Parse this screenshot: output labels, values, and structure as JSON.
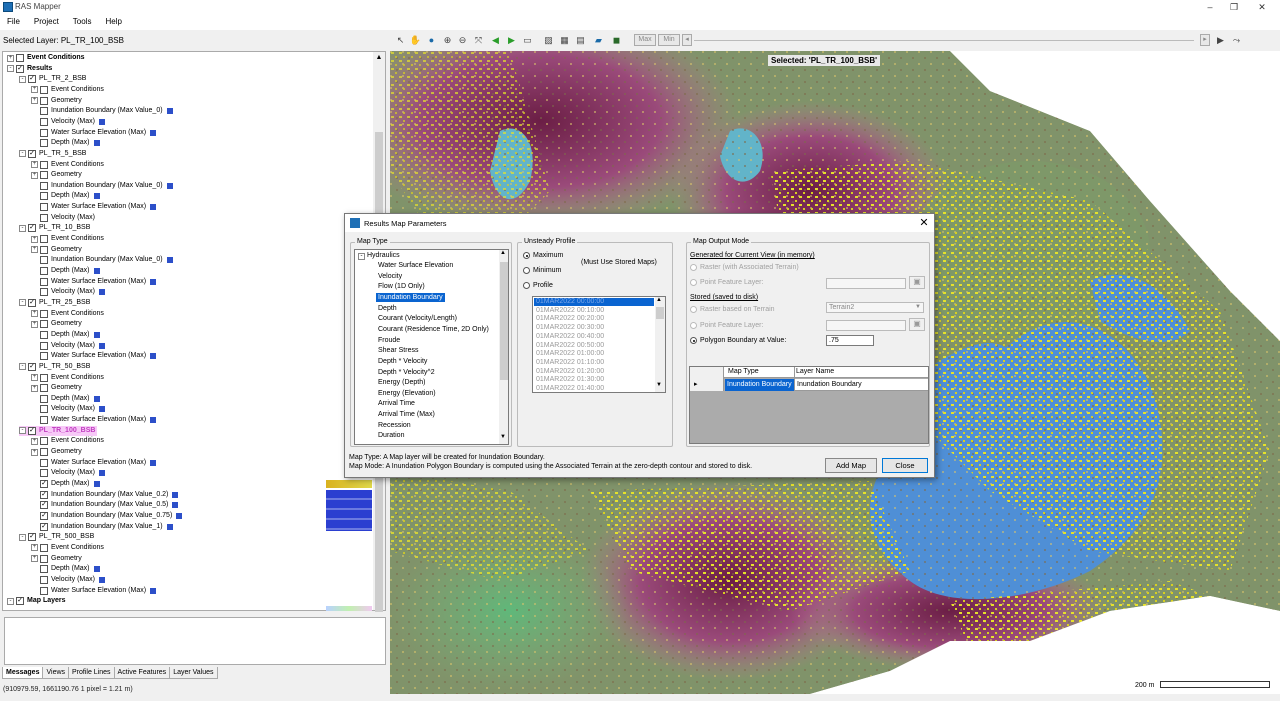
{
  "app": {
    "title": "RAS Mapper",
    "menu": [
      "File",
      "Project",
      "Tools",
      "Help"
    ]
  },
  "selected_layer": "Selected Layer: PL_TR_100_BSB",
  "toolbar": {
    "max_label": "Max",
    "min_label": "Min"
  },
  "map": {
    "selected_banner": "Selected: 'PL_TR_100_BSB'",
    "scale_label": "200 m"
  },
  "status": "(910979.59, 1661190.76  1 pixel = 1.21 m)",
  "bottom_tabs": [
    "Messages",
    "Views",
    "Profile Lines",
    "Active Features",
    "Layer Values"
  ],
  "tree": [
    {
      "t": "Event Conditions",
      "lvl": 0,
      "exp": "+",
      "cb": "",
      "bold": true
    },
    {
      "t": "Results",
      "lvl": 0,
      "exp": "-",
      "cb": "✓",
      "bold": true
    },
    {
      "t": "PL_TR_2_BSB",
      "lvl": 1,
      "exp": "-",
      "cb": "✓"
    },
    {
      "t": "Event Conditions",
      "lvl": 2,
      "exp": "+",
      "cb": ""
    },
    {
      "t": "Geometry",
      "lvl": 2,
      "exp": "+",
      "cb": ""
    },
    {
      "t": "Inundation Boundary (Max Value_0)",
      "lvl": 2,
      "cb": "",
      "mini": true
    },
    {
      "t": "Velocity (Max)",
      "lvl": 2,
      "cb": "",
      "mini": true
    },
    {
      "t": "Water Surface Elevation (Max)",
      "lvl": 2,
      "cb": "",
      "mini": true
    },
    {
      "t": "Depth (Max)",
      "lvl": 2,
      "cb": "",
      "mini": true
    },
    {
      "t": "PL_TR_5_BSB",
      "lvl": 1,
      "exp": "-",
      "cb": "✓"
    },
    {
      "t": "Event Conditions",
      "lvl": 2,
      "exp": "+",
      "cb": ""
    },
    {
      "t": "Geometry",
      "lvl": 2,
      "exp": "+",
      "cb": ""
    },
    {
      "t": "Inundation Boundary (Max Value_0)",
      "lvl": 2,
      "cb": "",
      "mini": true
    },
    {
      "t": "Depth (Max)",
      "lvl": 2,
      "cb": "",
      "mini": true
    },
    {
      "t": "Water Surface Elevation (Max)",
      "lvl": 2,
      "cb": "",
      "mini": true
    },
    {
      "t": "Velocity (Max)",
      "lvl": 2,
      "cb": ""
    },
    {
      "t": "PL_TR_10_BSB",
      "lvl": 1,
      "exp": "-",
      "cb": "✓"
    },
    {
      "t": "Event Conditions",
      "lvl": 2,
      "exp": "+",
      "cb": ""
    },
    {
      "t": "Geometry",
      "lvl": 2,
      "exp": "+",
      "cb": ""
    },
    {
      "t": "Inundation Boundary (Max Value_0)",
      "lvl": 2,
      "cb": "",
      "mini": true
    },
    {
      "t": "Depth (Max)",
      "lvl": 2,
      "cb": "",
      "mini": true
    },
    {
      "t": "Water Surface Elevation (Max)",
      "lvl": 2,
      "cb": "",
      "mini": true
    },
    {
      "t": "Velocity (Max)",
      "lvl": 2,
      "cb": "",
      "mini": true
    },
    {
      "t": "PL_TR_25_BSB",
      "lvl": 1,
      "exp": "-",
      "cb": "✓"
    },
    {
      "t": "Event Conditions",
      "lvl": 2,
      "exp": "+",
      "cb": ""
    },
    {
      "t": "Geometry",
      "lvl": 2,
      "exp": "+",
      "cb": ""
    },
    {
      "t": "Depth (Max)",
      "lvl": 2,
      "cb": "",
      "mini": true
    },
    {
      "t": "Velocity (Max)",
      "lvl": 2,
      "cb": "",
      "mini": true
    },
    {
      "t": "Water Surface Elevation (Max)",
      "lvl": 2,
      "cb": "",
      "mini": true
    },
    {
      "t": "PL_TR_50_BSB",
      "lvl": 1,
      "exp": "-",
      "cb": "✓"
    },
    {
      "t": "Event Conditions",
      "lvl": 2,
      "exp": "+",
      "cb": ""
    },
    {
      "t": "Geometry",
      "lvl": 2,
      "exp": "+",
      "cb": ""
    },
    {
      "t": "Depth (Max)",
      "lvl": 2,
      "cb": "",
      "mini": true
    },
    {
      "t": "Velocity (Max)",
      "lvl": 2,
      "cb": "",
      "mini": true
    },
    {
      "t": "Water Surface Elevation (Max)",
      "lvl": 2,
      "cb": "",
      "mini": true
    },
    {
      "t": "PL_TR_100_BSB",
      "lvl": 1,
      "exp": "-",
      "cb": "✓",
      "hl": true
    },
    {
      "t": "Event Conditions",
      "lvl": 2,
      "exp": "+",
      "cb": ""
    },
    {
      "t": "Geometry",
      "lvl": 2,
      "exp": "+",
      "cb": ""
    },
    {
      "t": "Water Surface Elevation (Max)",
      "lvl": 2,
      "cb": "",
      "mini": true
    },
    {
      "t": "Velocity (Max)",
      "lvl": 2,
      "cb": "",
      "mini": true
    },
    {
      "t": "Depth (Max)",
      "lvl": 2,
      "cb": "✓",
      "mini": true
    },
    {
      "t": "Inundation Boundary (Max Value_0.2)",
      "lvl": 2,
      "cb": "✓",
      "mini": true
    },
    {
      "t": "Inundation Boundary (Max Value_0.5)",
      "lvl": 2,
      "cb": "✓",
      "mini": true
    },
    {
      "t": "Inundation Boundary (Max Value_0.75)",
      "lvl": 2,
      "cb": "✓",
      "mini": true
    },
    {
      "t": "Inundation Boundary (Max Value_1)",
      "lvl": 2,
      "cb": "✓",
      "mini": true
    },
    {
      "t": "PL_TR_500_BSB",
      "lvl": 1,
      "exp": "-",
      "cb": "✓"
    },
    {
      "t": "Event Conditions",
      "lvl": 2,
      "exp": "+",
      "cb": ""
    },
    {
      "t": "Geometry",
      "lvl": 2,
      "exp": "+",
      "cb": ""
    },
    {
      "t": "Depth (Max)",
      "lvl": 2,
      "cb": "",
      "mini": true
    },
    {
      "t": "Velocity (Max)",
      "lvl": 2,
      "cb": "",
      "mini": true
    },
    {
      "t": "Water Surface Elevation (Max)",
      "lvl": 2,
      "cb": "",
      "mini": true
    },
    {
      "t": "Map Layers",
      "lvl": 0,
      "exp": "-",
      "cb": "✓",
      "bold": true
    }
  ],
  "dialog": {
    "title": "Results Map Parameters",
    "map_type": {
      "label": "Map Type",
      "root": "Hydraulics",
      "items": [
        "Water Surface Elevation",
        "Velocity",
        "Flow (1D Only)",
        "Inundation Boundary",
        "Depth",
        "Courant (Velocity/Length)",
        "Courant (Residence Time, 2D Only)",
        "Froude",
        "Shear Stress",
        "Depth * Velocity",
        "Depth * Velocity^2",
        "Energy (Depth)",
        "Energy (Elevation)",
        "Arrival Time",
        "Arrival Time (Max)",
        "Recession",
        "Duration"
      ],
      "selected": "Inundation Boundary"
    },
    "unsteady": {
      "label": "Unsteady Profile",
      "maximum": "Maximum",
      "minimum": "Minimum",
      "profile": "Profile",
      "note": "(Must Use Stored Maps)",
      "times": [
        "01MAR2022 00:00:00",
        "01MAR2022 00:10:00",
        "01MAR2022 00:20:00",
        "01MAR2022 00:30:00",
        "01MAR2022 00:40:00",
        "01MAR2022 00:50:00",
        "01MAR2022 01:00:00",
        "01MAR2022 01:10:00",
        "01MAR2022 01:20:00",
        "01MAR2022 01:30:00",
        "01MAR2022 01:40:00"
      ]
    },
    "output": {
      "label": "Map Output Mode",
      "current_view": "Generated for Current View (in memory)",
      "raster_assoc": "Raster (with Associated Terrain)",
      "point_feature": "Point Feature Layer:",
      "stored": "Stored (saved to disk)",
      "raster_terrain": "Raster based on Terrain",
      "terrain_value": "Terrain2",
      "point_feature2": "Point Feature Layer:",
      "polygon": "Polygon Boundary at Value:",
      "polygon_value": ".75",
      "grid_headers": [
        "Map Type",
        "Layer Name"
      ],
      "grid_row": [
        "Inundation Boundary",
        "Inundation Boundary"
      ]
    },
    "info1": "Map Type: A Map layer will be created for Inundation Boundary.",
    "info2": "Map Mode: A Inundation Polygon Boundary is computed using the Associated Terrain at the zero-depth contour and stored to disk.",
    "add_map": "Add Map",
    "close": "Close"
  }
}
